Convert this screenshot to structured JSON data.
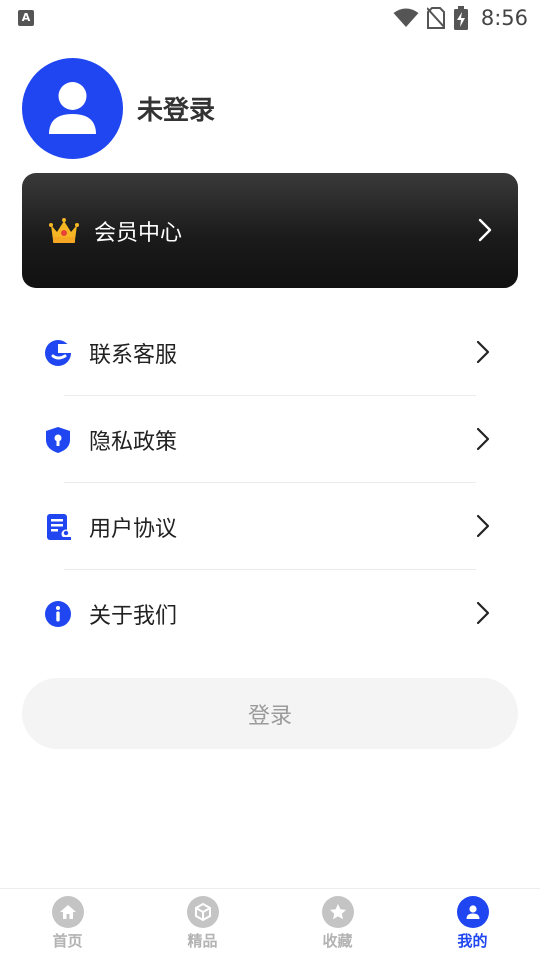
{
  "status_bar": {
    "time": "8:56",
    "app_badge": "A"
  },
  "profile": {
    "username": "未登录"
  },
  "vip": {
    "label": "会员中心"
  },
  "menu": [
    {
      "label": "联系客服",
      "icon": "customer-service-icon"
    },
    {
      "label": "隐私政策",
      "icon": "shield-icon"
    },
    {
      "label": "用户协议",
      "icon": "document-icon"
    },
    {
      "label": "关于我们",
      "icon": "info-icon"
    }
  ],
  "login_button": "登录",
  "tabs": [
    {
      "label": "首页",
      "icon": "home-icon",
      "active": false
    },
    {
      "label": "精品",
      "icon": "box-icon",
      "active": false
    },
    {
      "label": "收藏",
      "icon": "star-icon",
      "active": false
    },
    {
      "label": "我的",
      "icon": "user-icon",
      "active": true
    }
  ],
  "colors": {
    "accent": "#1f46f0",
    "inactive": "#b3b3b3",
    "vip_bg": "#1b1b1b"
  }
}
